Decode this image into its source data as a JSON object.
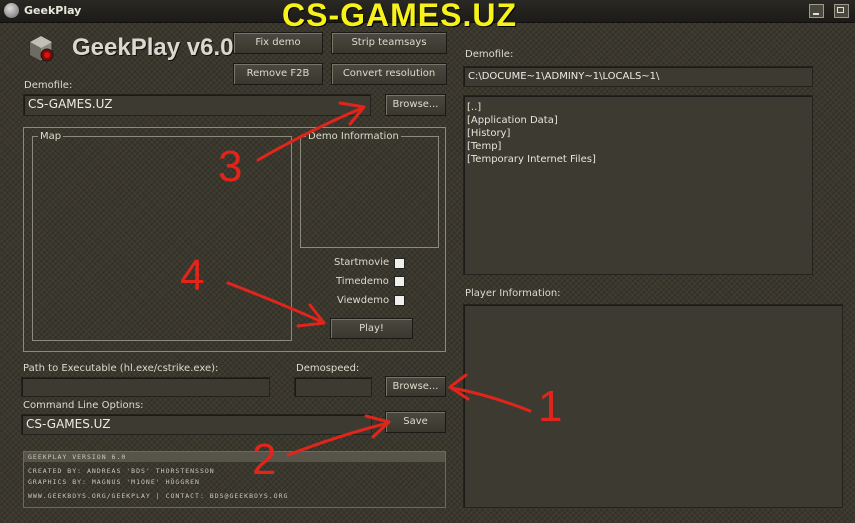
{
  "window": {
    "title": "GeekPlay"
  },
  "overlay": {
    "title": "CS-GAMES.UZ"
  },
  "logo": {
    "text": "GeekPlay v6.0"
  },
  "toolbar": {
    "fix_demo": "Fix demo",
    "strip_teamsays": "Strip teamsays",
    "remove_f2b": "Remove F2B",
    "convert_resolution": "Convert resolution"
  },
  "demofile": {
    "label": "Demofile:",
    "value": "CS-GAMES.UZ",
    "browse": "Browse..."
  },
  "map": {
    "label": "Map"
  },
  "demo_info": {
    "label": "Demo Information"
  },
  "options": {
    "startmovie": "Startmovie",
    "timedemo": "Timedemo",
    "viewdemo": "Viewdemo"
  },
  "play": {
    "label": "Play!"
  },
  "path": {
    "label": "Path to Executable (hl.exe/cstrike.exe):",
    "value": ""
  },
  "demospeed": {
    "label": "Demospeed:",
    "value": "",
    "browse": "Browse..."
  },
  "cmdline": {
    "label": "Command Line Options:",
    "value": "CS-GAMES.UZ",
    "save": "Save"
  },
  "credits": {
    "version": "GEEKPLAY VERSION 6.0",
    "created_by": "CREATED BY: ANDREAS 'BDS' THORSTENSSON",
    "graphics_by": "GRAPHICS BY: MAGNUS 'M1ONE' HÖGGREN",
    "links": "WWW.GEEKBOYS.ORG/GEEKPLAY  |  CONTACT: BDS@GEEKBOYS.ORG"
  },
  "right_panel": {
    "demofile_label": "Demofile:",
    "path": "C:\\DOCUME~1\\ADMINY~1\\LOCALS~1\\",
    "files": [
      "[..]",
      "[Application Data]",
      "[History]",
      "[Temp]",
      "[Temporary Internet Files]"
    ],
    "player_info_label": "Player Information:"
  },
  "annotations": {
    "n1": "1",
    "n2": "2",
    "n3": "3",
    "n4": "4"
  },
  "colors": {
    "annotation": "#e1251b",
    "overlay_title": "#f7f21a"
  }
}
